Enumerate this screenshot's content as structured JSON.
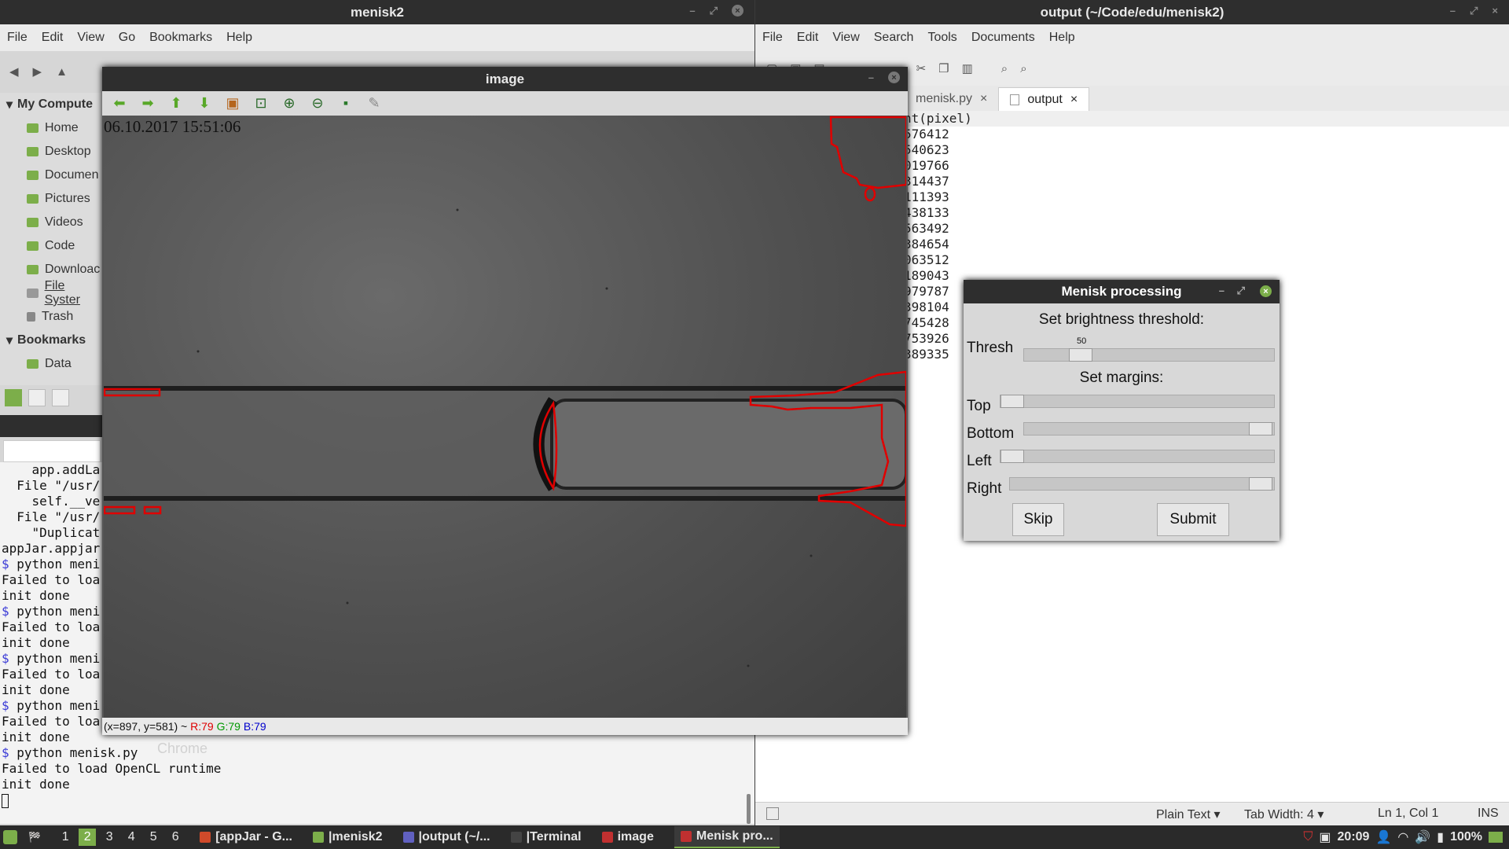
{
  "file_manager": {
    "title": "menisk2",
    "menu": [
      "File",
      "Edit",
      "View",
      "Go",
      "Bookmarks",
      "Help"
    ],
    "sidebar": {
      "computer_header": "My Compute",
      "items": [
        "Home",
        "Desktop",
        "Documen",
        "Pictures",
        "Videos",
        "Code",
        "Downloac",
        "File Syster",
        "Trash"
      ],
      "bookmarks_header": "Bookmarks",
      "bookmark_items": [
        "Data"
      ]
    }
  },
  "terminal": {
    "lines": [
      {
        "prompt": false,
        "text": "    app.addLa"
      },
      {
        "prompt": false,
        "text": "  File \"/usr/"
      },
      {
        "prompt": false,
        "text": "    self.__ve"
      },
      {
        "prompt": false,
        "text": "  File \"/usr/"
      },
      {
        "prompt": false,
        "text": "    \"Duplicat"
      },
      {
        "prompt": false,
        "text": "appJar.appjar"
      },
      {
        "prompt": true,
        "text": " python meni"
      },
      {
        "prompt": false,
        "text": "Failed to loa"
      },
      {
        "prompt": false,
        "text": "init done"
      },
      {
        "prompt": true,
        "text": " python meni"
      },
      {
        "prompt": false,
        "text": "Failed to loa"
      },
      {
        "prompt": false,
        "text": "init done"
      },
      {
        "prompt": true,
        "text": " python meni"
      },
      {
        "prompt": false,
        "text": "Failed to loa"
      },
      {
        "prompt": false,
        "text": "init done"
      },
      {
        "prompt": true,
        "text": " python meni"
      },
      {
        "prompt": false,
        "text": "Failed to loa"
      },
      {
        "prompt": false,
        "text": "init done"
      },
      {
        "prompt": true,
        "text": " python menisk.py"
      },
      {
        "prompt": false,
        "text": "Failed to load OpenCL runtime"
      },
      {
        "prompt": false,
        "text": "init done"
      }
    ],
    "prompt_symbol": "$",
    "desktop_label": "Chrome"
  },
  "editor": {
    "title": "output (~/Code/edu/menisk2)",
    "menu": [
      "File",
      "Edit",
      "View",
      "Search",
      "Tools",
      "Documents",
      "Help"
    ],
    "tabs": [
      {
        "label": "menisk.py",
        "active": false
      },
      {
        "label": "output",
        "active": true
      }
    ],
    "tab_close": "×",
    "lines": [
      "nt(pixel)",
      "576412",
      "540623",
      "019766",
      "314437",
      "111393",
      "438133",
      "563492",
      "384654",
      "063512",
      "189043",
      "979787",
      "398104",
      "745428",
      "753926",
      "389335"
    ],
    "status": {
      "mode": "Plain Text",
      "tab_width": "Tab Width: 4",
      "position": "Ln 1, Col 1",
      "ins": "INS"
    }
  },
  "image_window": {
    "title": "image",
    "timestamp": "06.10.2017 15:51:06",
    "status_coords": "(x=897, y=581) ~ ",
    "status_r": "R:79",
    "status_g": "G:79",
    "status_b": "B:79",
    "colors": {
      "contour": "#e00000",
      "toolbar_arrow": "#58a828"
    }
  },
  "menisk_dialog": {
    "title": "Menisk processing",
    "brightness_label": "Set brightness threshold:",
    "thresh_label": "Thresh",
    "thresh_value": "50",
    "thresh_fraction": 0.2,
    "margins_label": "Set margins:",
    "top_label": "Top",
    "bottom_label": "Bottom",
    "left_label": "Left",
    "right_label": "Right",
    "margin_fractions": {
      "top": 0.0,
      "bottom": 1.0,
      "left": 0.0,
      "right": 1.0
    },
    "skip_label": "Skip",
    "submit_label": "Submit"
  },
  "taskbar": {
    "workspaces": [
      "1",
      "2",
      "3",
      "4",
      "5",
      "6"
    ],
    "active_workspace": "2",
    "tasks": [
      {
        "label": "[appJar - G...",
        "color": "#d04a2a"
      },
      {
        "label": "|menisk2",
        "color": "#7cae4a"
      },
      {
        "label": "|output (~/...",
        "color": "#6060c0"
      },
      {
        "label": "|Terminal",
        "color": "#444444"
      },
      {
        "label": "image",
        "color": "#c03030"
      },
      {
        "label": "Menisk pro...",
        "color": "#c03030"
      }
    ],
    "clock": "20:09",
    "battery": "100%"
  }
}
